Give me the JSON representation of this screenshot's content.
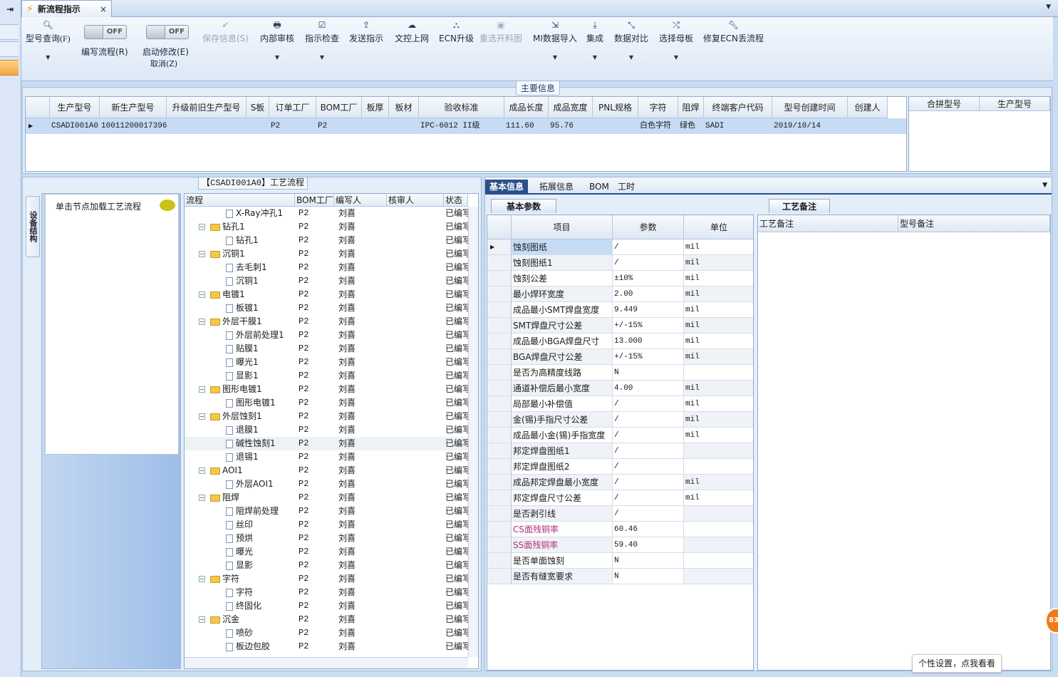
{
  "window": {
    "tab_title": "新流程指示",
    "close_glyph": "×"
  },
  "toolbar": {
    "model_query": "型号查询(F)",
    "write_flow": "编写流程(R)",
    "start_modify": "启动修改(E)",
    "cancel": "取消(Z)",
    "toggle_off_1": "OFF",
    "toggle_off_2": "OFF",
    "save_info": "保存信息(S)",
    "internal_review": "内部审核",
    "instruction_check": "指示检查",
    "send_instruction": "发送指示",
    "doc_online": "文控上网",
    "ecn_upgrade": "ECN升级",
    "reselect_drawing": "重选开料图",
    "mi_import": "MI数据导入",
    "integrate": "集成",
    "data_compare": "数据对比",
    "select_mother": "选择母板",
    "fix_ecn": "修复ECN丢流程"
  },
  "main_info": {
    "legend": "主要信息",
    "columns": [
      "生产型号",
      "新生产型号",
      "升级前旧生产型号",
      "S板",
      "订单工厂",
      "BOM工厂",
      "板厚",
      "板材",
      "验收标准",
      "成品长度",
      "成品宽度",
      "PNL规格",
      "字符",
      "阻焊",
      "终端客户代码",
      "型号创建时间",
      "创建人"
    ],
    "row": [
      "CSADI001A0",
      "10011200017396",
      "",
      "",
      "P2",
      "P2",
      "",
      "",
      "IPC-6012 II级",
      "111.60",
      "95.76",
      "",
      "白色字符",
      "绿色",
      "SADI",
      "2019/10/14",
      ""
    ],
    "side_columns": [
      "合拼型号",
      "生产型号"
    ]
  },
  "left": {
    "vertical_tab": "设备结构",
    "node_hint": "单击节点加载工艺流程",
    "tree_title": "【CSADI001A0】工艺流程",
    "tree_columns": [
      "流程",
      "BOM工厂",
      "编写人",
      "核审人",
      "状态"
    ],
    "tree_rows": [
      {
        "name": "X-Ray冲孔1",
        "level": 2,
        "folder": false,
        "bom": "P2",
        "writer": "刘喜",
        "status": "已编写"
      },
      {
        "name": "钻孔1",
        "level": 1,
        "folder": true,
        "bom": "P2",
        "writer": "刘喜",
        "status": "已编写"
      },
      {
        "name": "钻孔1",
        "level": 2,
        "folder": false,
        "bom": "P2",
        "writer": "刘喜",
        "status": "已编写"
      },
      {
        "name": "沉铜1",
        "level": 1,
        "folder": true,
        "bom": "P2",
        "writer": "刘喜",
        "status": "已编写"
      },
      {
        "name": "去毛刺1",
        "level": 2,
        "folder": false,
        "bom": "P2",
        "writer": "刘喜",
        "status": "已编写"
      },
      {
        "name": "沉铜1",
        "level": 2,
        "folder": false,
        "bom": "P2",
        "writer": "刘喜",
        "status": "已编写"
      },
      {
        "name": "电镀1",
        "level": 1,
        "folder": true,
        "bom": "P2",
        "writer": "刘喜",
        "status": "已编写"
      },
      {
        "name": "板镀1",
        "level": 2,
        "folder": false,
        "bom": "P2",
        "writer": "刘喜",
        "status": "已编写"
      },
      {
        "name": "外层干膜1",
        "level": 1,
        "folder": true,
        "bom": "P2",
        "writer": "刘喜",
        "status": "已编写"
      },
      {
        "name": "外层前处理1",
        "level": 2,
        "folder": false,
        "bom": "P2",
        "writer": "刘喜",
        "status": "已编写"
      },
      {
        "name": "贴膜1",
        "level": 2,
        "folder": false,
        "bom": "P2",
        "writer": "刘喜",
        "status": "已编写"
      },
      {
        "name": "曝光1",
        "level": 2,
        "folder": false,
        "bom": "P2",
        "writer": "刘喜",
        "status": "已编写"
      },
      {
        "name": "显影1",
        "level": 2,
        "folder": false,
        "bom": "P2",
        "writer": "刘喜",
        "status": "已编写"
      },
      {
        "name": "图形电镀1",
        "level": 1,
        "folder": true,
        "bom": "P2",
        "writer": "刘喜",
        "status": "已编写"
      },
      {
        "name": "图形电镀1",
        "level": 2,
        "folder": false,
        "bom": "P2",
        "writer": "刘喜",
        "status": "已编写"
      },
      {
        "name": "外层蚀刻1",
        "level": 1,
        "folder": true,
        "bom": "P2",
        "writer": "刘喜",
        "status": "已编写"
      },
      {
        "name": "退膜1",
        "level": 2,
        "folder": false,
        "bom": "P2",
        "writer": "刘喜",
        "status": "已编写"
      },
      {
        "name": "碱性蚀刻1",
        "level": 2,
        "folder": false,
        "bom": "P2",
        "writer": "刘喜",
        "status": "已编写"
      },
      {
        "name": "退锡1",
        "level": 2,
        "folder": false,
        "bom": "P2",
        "writer": "刘喜",
        "status": "已编写"
      },
      {
        "name": "AOI1",
        "level": 1,
        "folder": true,
        "bom": "P2",
        "writer": "刘喜",
        "status": "已编写"
      },
      {
        "name": "外层AOI1",
        "level": 2,
        "folder": false,
        "bom": "P2",
        "writer": "刘喜",
        "status": "已编写"
      },
      {
        "name": "阻焊",
        "level": 1,
        "folder": true,
        "bom": "P2",
        "writer": "刘喜",
        "status": "已编写"
      },
      {
        "name": "阻焊前处理",
        "level": 2,
        "folder": false,
        "bom": "P2",
        "writer": "刘喜",
        "status": "已编写"
      },
      {
        "name": "丝印",
        "level": 2,
        "folder": false,
        "bom": "P2",
        "writer": "刘喜",
        "status": "已编写"
      },
      {
        "name": "预烘",
        "level": 2,
        "folder": false,
        "bom": "P2",
        "writer": "刘喜",
        "status": "已编写"
      },
      {
        "name": "曝光",
        "level": 2,
        "folder": false,
        "bom": "P2",
        "writer": "刘喜",
        "status": "已编写"
      },
      {
        "name": "显影",
        "level": 2,
        "folder": false,
        "bom": "P2",
        "writer": "刘喜",
        "status": "已编写"
      },
      {
        "name": "字符",
        "level": 1,
        "folder": true,
        "bom": "P2",
        "writer": "刘喜",
        "status": "已编写"
      },
      {
        "name": "字符",
        "level": 2,
        "folder": false,
        "bom": "P2",
        "writer": "刘喜",
        "status": "已编写"
      },
      {
        "name": "终固化",
        "level": 2,
        "folder": false,
        "bom": "P2",
        "writer": "刘喜",
        "status": "已编写"
      },
      {
        "name": "沉金",
        "level": 1,
        "folder": true,
        "bom": "P2",
        "writer": "刘喜",
        "status": "已编写"
      },
      {
        "name": "喷砂",
        "level": 2,
        "folder": false,
        "bom": "P2",
        "writer": "刘喜",
        "status": "已编写"
      },
      {
        "name": "板边包胶",
        "level": 2,
        "folder": false,
        "bom": "P2",
        "writer": "刘喜",
        "status": "已编写"
      }
    ]
  },
  "right": {
    "tabs": [
      "基本信息",
      "拓展信息",
      "BOM",
      "工时"
    ],
    "sub_tab": "基本参数",
    "param_columns": [
      "项目",
      "参数",
      "单位"
    ],
    "params": [
      {
        "item": "蚀刻图纸",
        "value": "/",
        "unit": "mil"
      },
      {
        "item": "蚀刻图纸1",
        "value": "/",
        "unit": "mil"
      },
      {
        "item": "蚀刻公差",
        "value": "±10%",
        "unit": "mil"
      },
      {
        "item": "最小焊环宽度",
        "value": "2.00",
        "unit": "mil"
      },
      {
        "item": "成品最小SMT焊盘宽度",
        "value": "9.449",
        "unit": "mil"
      },
      {
        "item": "SMT焊盘尺寸公差",
        "value": "+/-15%",
        "unit": "mil"
      },
      {
        "item": "成品最小BGA焊盘尺寸",
        "value": "13.000",
        "unit": "mil"
      },
      {
        "item": "BGA焊盘尺寸公差",
        "value": "+/-15%",
        "unit": "mil"
      },
      {
        "item": "是否为高精度线路",
        "value": "N",
        "unit": ""
      },
      {
        "item": "通道补偿后最小宽度",
        "value": "4.00",
        "unit": "mil"
      },
      {
        "item": "局部最小补偿值",
        "value": "/",
        "unit": "mil"
      },
      {
        "item": "金(锡)手指尺寸公差",
        "value": "/",
        "unit": "mil"
      },
      {
        "item": "成品最小金(锡)手指宽度",
        "value": "/",
        "unit": "mil"
      },
      {
        "item": "邦定焊盘图纸1",
        "value": "/",
        "unit": ""
      },
      {
        "item": "邦定焊盘图纸2",
        "value": "/",
        "unit": ""
      },
      {
        "item": "成品邦定焊盘最小宽度",
        "value": "/",
        "unit": "mil"
      },
      {
        "item": "邦定焊盘尺寸公差",
        "value": "/",
        "unit": "mil"
      },
      {
        "item": "是否剥引线",
        "value": "/",
        "unit": ""
      },
      {
        "item": "CS面残铜率",
        "value": "60.46",
        "unit": "",
        "pink": true
      },
      {
        "item": "SS面残铜率",
        "value": "59.40",
        "unit": "",
        "pink": true
      },
      {
        "item": "是否单面蚀刻",
        "value": "N",
        "unit": ""
      },
      {
        "item": "是否有缝宽要求",
        "value": "N",
        "unit": ""
      }
    ],
    "notes_tab": "工艺备注",
    "notes_columns": [
      "工艺备注",
      "型号备注"
    ]
  },
  "overlay": {
    "tip": "个性设置，点我看看",
    "badge": "83"
  }
}
